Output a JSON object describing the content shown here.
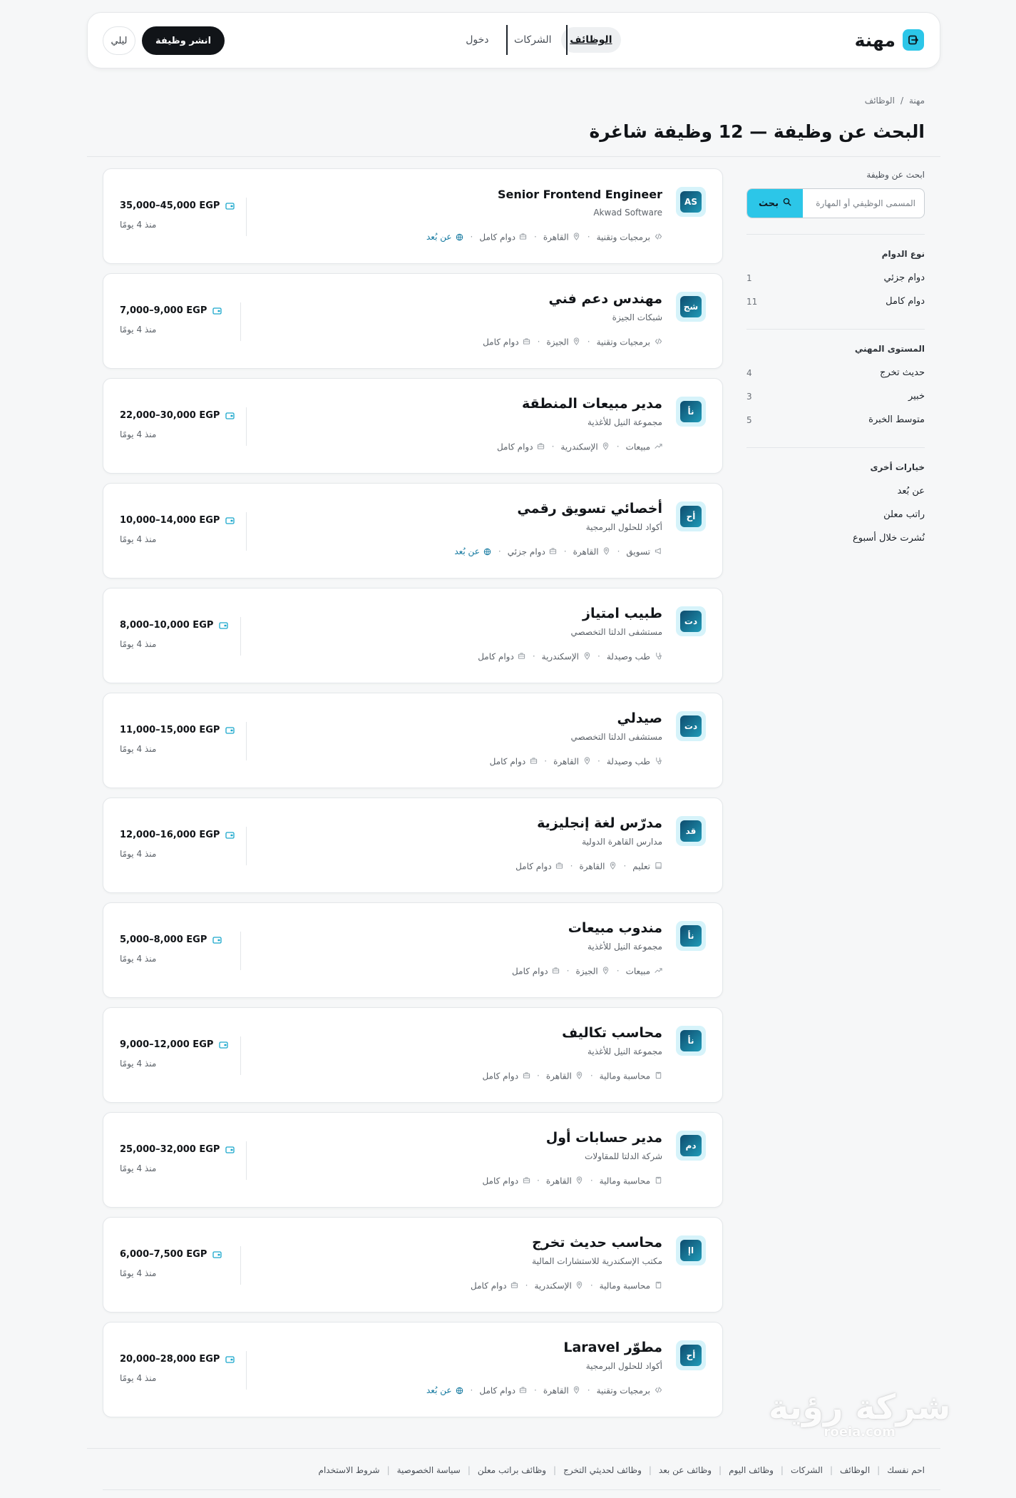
{
  "header": {
    "brand": "مهنة",
    "nav": {
      "jobs": "الوظائف",
      "companies": "الشركات",
      "login": "دخول"
    },
    "post_job": "انشر وظيفة",
    "theme_toggle": "ليلي"
  },
  "breadcrumb": {
    "home": "مهنة",
    "separator": "/",
    "current": "الوظائف"
  },
  "page_title": "البحث عن وظيفة — 12 وظيفة شاغرة",
  "sidebar": {
    "search_label": "ابحث عن وظيفة",
    "search_placeholder": "المسمى الوظيفي أو المهارة",
    "search_button": "بحث",
    "job_type": {
      "heading": "نوع الدوام",
      "items": [
        {
          "label": "دوام جزئي",
          "count": "1"
        },
        {
          "label": "دوام كامل",
          "count": "11"
        }
      ]
    },
    "level": {
      "heading": "المستوى المهني",
      "items": [
        {
          "label": "حديث تخرج",
          "count": "4"
        },
        {
          "label": "خبير",
          "count": "3"
        },
        {
          "label": "متوسط الخبرة",
          "count": "5"
        }
      ]
    },
    "other": {
      "heading": "خيارات أخرى",
      "items": [
        {
          "label": "عن بُعد"
        },
        {
          "label": "راتب معلن"
        },
        {
          "label": "نُشرت خلال أسبوع"
        }
      ]
    }
  },
  "jobs": [
    {
      "logo": "AS",
      "title": "Senior Frontend Engineer",
      "company": "Akwad Software",
      "category": "برمجيات وتقنية",
      "category_icon": "code-icon",
      "city": "القاهرة",
      "type": "دوام كامل",
      "remote": "عن بُعد",
      "salary": "35,000–45,000 EGP",
      "posted": "منذ 4 يومًا"
    },
    {
      "logo": "شج",
      "title": "مهندس دعم فني",
      "company": "شبكات الجيزة",
      "category": "برمجيات وتقنية",
      "category_icon": "code-icon",
      "city": "الجيزة",
      "type": "دوام كامل",
      "remote": "",
      "salary": "7,000–9,000 EGP",
      "posted": "منذ 4 يومًا"
    },
    {
      "logo": "نأ",
      "title": "مدير مبيعات المنطقة",
      "company": "مجموعة النيل للأغذية",
      "category": "مبيعات",
      "category_icon": "trend-icon",
      "city": "الإسكندرية",
      "type": "دوام كامل",
      "remote": "",
      "salary": "22,000–30,000 EGP",
      "posted": "منذ 4 يومًا"
    },
    {
      "logo": "أح",
      "title": "أخصائي تسويق رقمي",
      "company": "أكواد للحلول البرمجية",
      "category": "تسويق",
      "category_icon": "megaphone-icon",
      "city": "القاهرة",
      "type": "دوام جزئي",
      "remote": "عن بُعد",
      "salary": "10,000–14,000 EGP",
      "posted": "منذ 4 يومًا"
    },
    {
      "logo": "دت",
      "title": "طبيب امتياز",
      "company": "مستشفى الدلتا التخصصي",
      "category": "طب وصيدلة",
      "category_icon": "medical-icon",
      "city": "الإسكندرية",
      "type": "دوام كامل",
      "remote": "",
      "salary": "8,000–10,000 EGP",
      "posted": "منذ 4 يومًا"
    },
    {
      "logo": "دت",
      "title": "صيدلي",
      "company": "مستشفى الدلتا التخصصي",
      "category": "طب وصيدلة",
      "category_icon": "medical-icon",
      "city": "القاهرة",
      "type": "دوام كامل",
      "remote": "",
      "salary": "11,000–15,000 EGP",
      "posted": "منذ 4 يومًا"
    },
    {
      "logo": "قد",
      "title": "مدرّس لغة إنجليزية",
      "company": "مدارس القاهرة الدولية",
      "category": "تعليم",
      "category_icon": "book-icon",
      "city": "القاهرة",
      "type": "دوام كامل",
      "remote": "",
      "salary": "12,000–16,000 EGP",
      "posted": "منذ 4 يومًا"
    },
    {
      "logo": "نأ",
      "title": "مندوب مبيعات",
      "company": "مجموعة النيل للأغذية",
      "category": "مبيعات",
      "category_icon": "trend-icon",
      "city": "الجيزة",
      "type": "دوام كامل",
      "remote": "",
      "salary": "5,000–8,000 EGP",
      "posted": "منذ 4 يومًا"
    },
    {
      "logo": "نأ",
      "title": "محاسب تكاليف",
      "company": "مجموعة النيل للأغذية",
      "category": "محاسبة ومالية",
      "category_icon": "ledger-icon",
      "city": "القاهرة",
      "type": "دوام كامل",
      "remote": "",
      "salary": "9,000–12,000 EGP",
      "posted": "منذ 4 يومًا"
    },
    {
      "logo": "دم",
      "title": "مدير حسابات أول",
      "company": "شركة الدلتا للمقاولات",
      "category": "محاسبة ومالية",
      "category_icon": "ledger-icon",
      "city": "القاهرة",
      "type": "دوام كامل",
      "remote": "",
      "salary": "25,000–32,000 EGP",
      "posted": "منذ 4 يومًا"
    },
    {
      "logo": "اإ",
      "title": "محاسب حديث تخرج",
      "company": "مكتب الإسكندرية للاستشارات المالية",
      "category": "محاسبة ومالية",
      "category_icon": "ledger-icon",
      "city": "الإسكندرية",
      "type": "دوام كامل",
      "remote": "",
      "salary": "6,000–7,500 EGP",
      "posted": "منذ 4 يومًا"
    },
    {
      "logo": "أح",
      "title": "مطوّر Laravel",
      "company": "أكواد للحلول البرمجية",
      "category": "برمجيات وتقنية",
      "category_icon": "code-icon",
      "city": "القاهرة",
      "type": "دوام كامل",
      "remote": "عن بُعد",
      "salary": "20,000–28,000 EGP",
      "posted": "منذ 4 يومًا"
    }
  ],
  "footer": {
    "links": [
      "احم نفسك",
      "الوظائف",
      "الشركات",
      "وظائف اليوم",
      "وظائف عن بعد",
      "وظائف لحديثي التخرج",
      "وظائف براتب معلن",
      "سياسة الخصوصية",
      "شروط الاستخدام"
    ]
  },
  "watermark": {
    "text": "شركة رؤية",
    "url": "roeia.com"
  },
  "colors": {
    "accent": "#2cc6e8",
    "primary_dark": "#111418",
    "remote_link": "#1479a0",
    "background": "#f6f7f8"
  }
}
